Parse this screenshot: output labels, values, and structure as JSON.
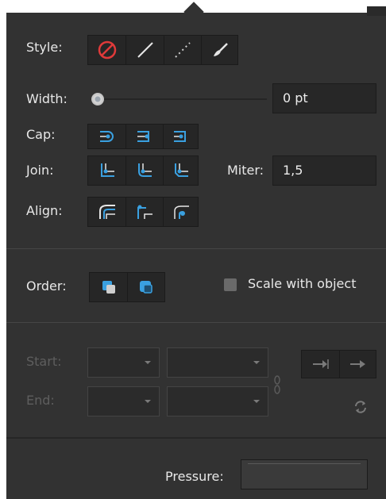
{
  "stroke": {
    "style_label": "Style:",
    "style_options": [
      "no-stroke-icon",
      "solid-line-icon",
      "dotted-line-icon",
      "brush-stroke-icon"
    ],
    "width_label": "Width:",
    "width_value": "0 pt",
    "width_slider_level": 0,
    "cap_label": "Cap:",
    "cap_options": [
      "butt-cap-icon",
      "round-cap-icon",
      "square-cap-icon"
    ],
    "join_label": "Join:",
    "join_options": [
      "miter-join-icon",
      "round-join-icon",
      "bevel-join-icon"
    ],
    "miter_label": "Miter:",
    "miter_value": "1,5",
    "align_label": "Align:",
    "align_options": [
      "align-inside-icon",
      "align-center-icon",
      "align-outside-icon"
    ]
  },
  "order": {
    "label": "Order:",
    "options": [
      "stroke-behind-fill-icon",
      "stroke-in-front-icon"
    ],
    "scale_label": "Scale with object",
    "scale_checked": false
  },
  "arrowheads": {
    "start_label": "Start:",
    "end_label": "End:",
    "enabled": false
  },
  "pressure": {
    "label": "Pressure:"
  },
  "colors": {
    "panel_bg": "#323232",
    "accent": "#3aa0e0",
    "no_stroke_red": "#e03a3a",
    "text": "#e8e8e8",
    "disabled_text": "#5e5e5e"
  }
}
